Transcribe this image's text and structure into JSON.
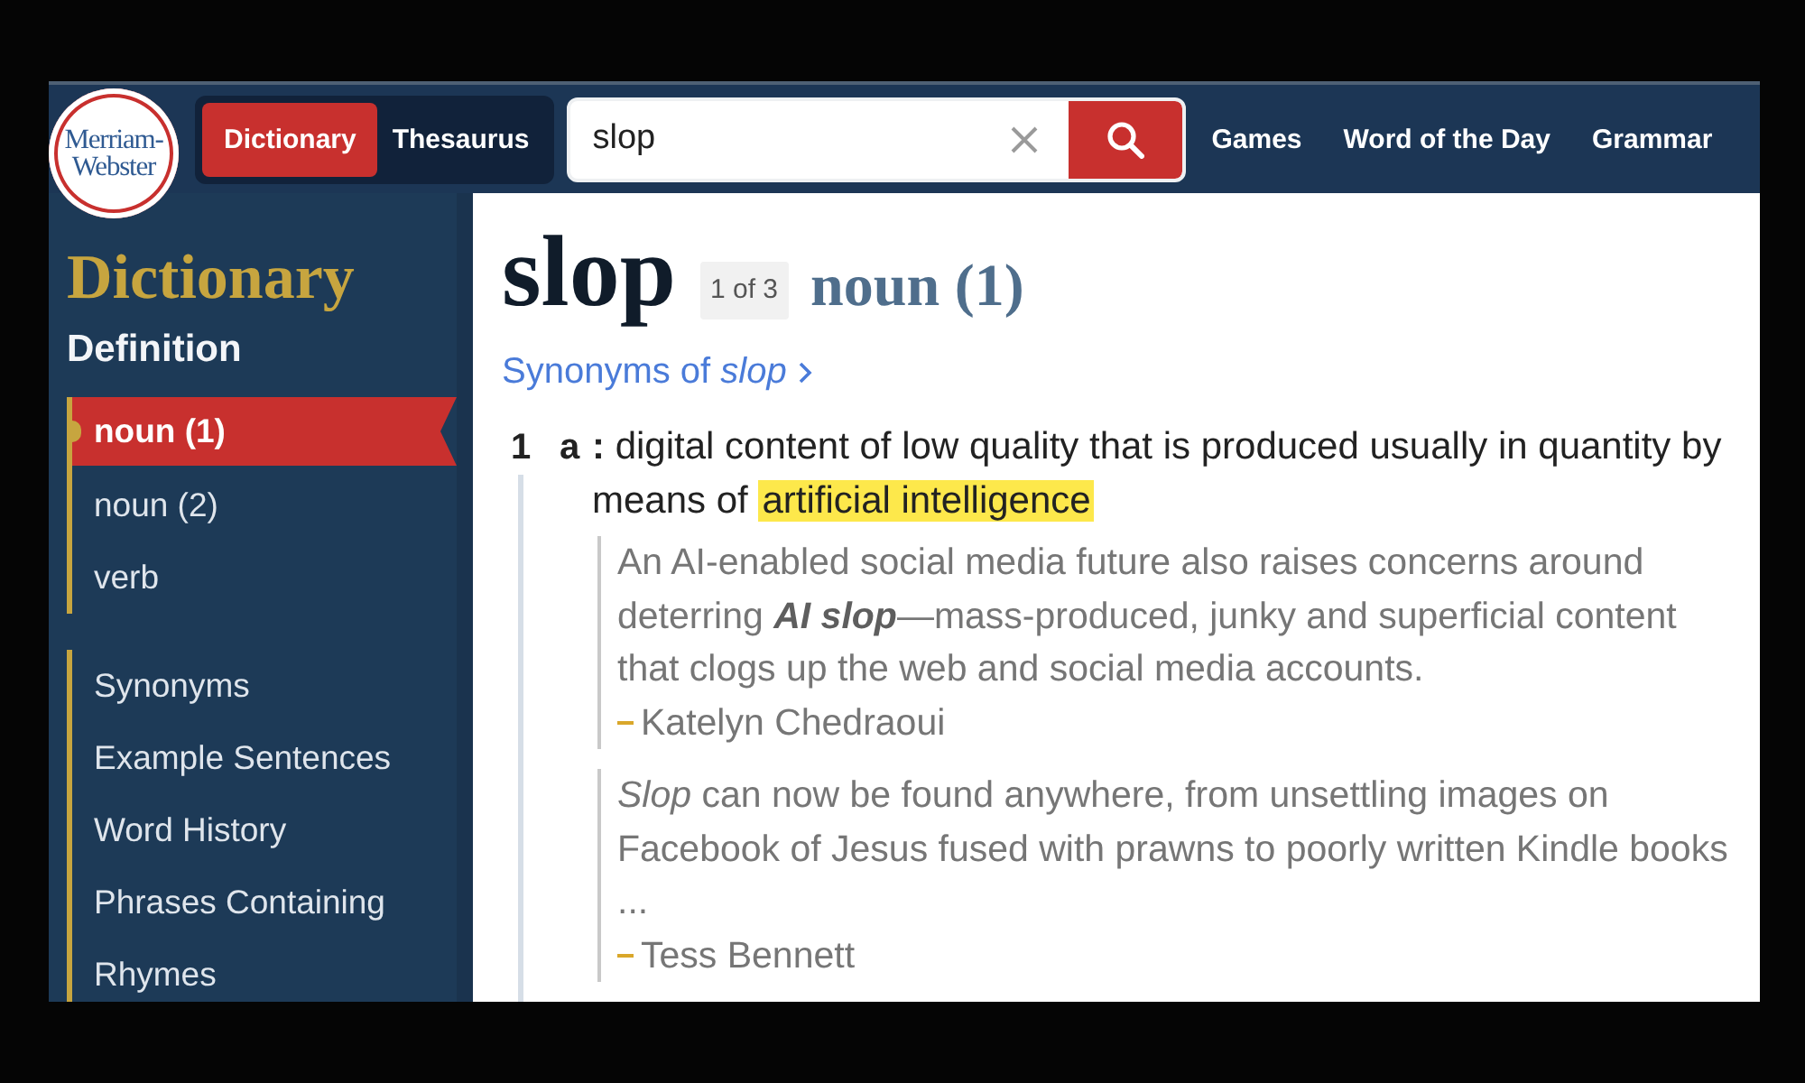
{
  "header": {
    "logo": [
      "Merriam-",
      "Webster"
    ],
    "tabs": [
      {
        "label": "Dictionary",
        "selected": true
      },
      {
        "label": "Thesaurus",
        "selected": false
      }
    ],
    "search": {
      "value": "slop"
    },
    "nav_links": [
      "Games",
      "Word of the Day",
      "Grammar"
    ]
  },
  "sidebar": {
    "title": "Dictionary",
    "heading": "Definition",
    "sections": [
      {
        "items": [
          {
            "label": "noun (1)",
            "selected": true
          },
          {
            "label": "noun (2)",
            "selected": false
          },
          {
            "label": "verb",
            "selected": false
          }
        ]
      },
      {
        "items": [
          {
            "label": "Synonyms",
            "selected": false
          },
          {
            "label": "Example Sentences",
            "selected": false
          },
          {
            "label": "Word History",
            "selected": false
          },
          {
            "label": "Phrases Containing",
            "selected": false
          },
          {
            "label": "Rhymes",
            "selected": false
          }
        ]
      }
    ]
  },
  "entry": {
    "headword": "slop",
    "homograph": "1 of 3",
    "part_of_speech": "noun (1)",
    "synonyms_link": "Synonyms of *slop*",
    "senses": [
      {
        "number": "1",
        "letter": "a",
        "definition": "**:** digital content of low quality that is produced usually in quantity by means of",
        "highlight": "artificial intelligence",
        "examples": [
          {
            "text": "An AI-enabled social media future also raises concerns around deterring **AI slop**—mass-produced, junky and superficial content that clogs up the web and social media accounts.",
            "attribution": "Katelyn Chedraoui"
          },
          {
            "text": "*Slop* can now be found anywhere, from unsettling images on Facebook of Jesus fused with prawns to poorly written Kindle books ...",
            "attribution": "Tess Bennett"
          }
        ]
      }
    ]
  }
}
